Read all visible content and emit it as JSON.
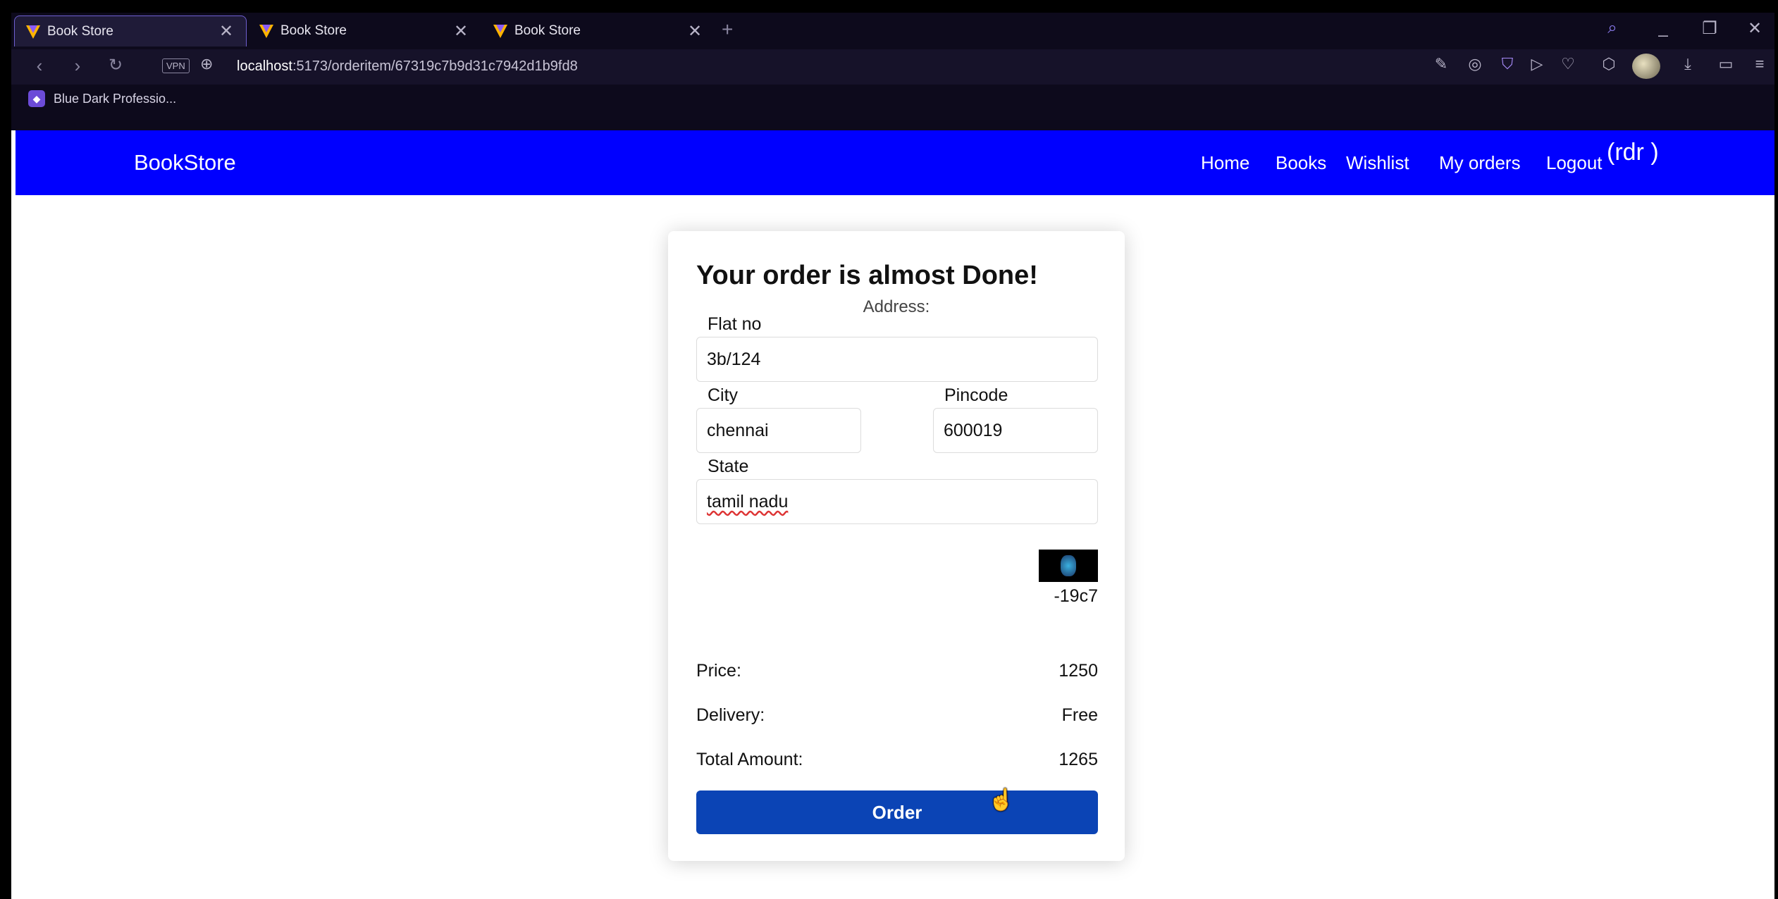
{
  "browser": {
    "tabs": [
      {
        "title": "Book Store",
        "active": true
      },
      {
        "title": "Book Store",
        "active": false
      },
      {
        "title": "Book Store",
        "active": false
      }
    ],
    "new_tab_glyph": "+",
    "url": {
      "host": "localhost",
      "path": ":5173/orderitem/67319c7b9d31c7942d1b9fd8"
    },
    "vpn_label": "VPN",
    "bookmarks": [
      {
        "label": "Blue Dark Professio..."
      }
    ]
  },
  "navbar": {
    "brand": "BookStore",
    "links": [
      "Home",
      "Books",
      "Wishlist",
      "My orders",
      "Logout"
    ],
    "user": "(rdr )"
  },
  "order_form": {
    "title": "Your order is almost Done!",
    "address_label": "Address:",
    "flat": {
      "label": "Flat no",
      "value": "3b/124"
    },
    "city": {
      "label": "City",
      "value": "chennai"
    },
    "pincode": {
      "label": "Pincode",
      "value": "600019"
    },
    "state": {
      "label": "State",
      "value": "tamil nadu"
    },
    "book_id": "-19c7",
    "summary": {
      "price_label": "Price:",
      "price_value": "1250",
      "delivery_label": "Delivery:",
      "delivery_value": "Free",
      "total_label": "Total Amount:",
      "total_value": "1265"
    },
    "order_button": "Order"
  },
  "colors": {
    "navbar_bg": "#0000ff",
    "order_button": "#0b44b5",
    "browser_chrome": "#0d0a1c",
    "tab_active_border": "#6e5fd0"
  }
}
